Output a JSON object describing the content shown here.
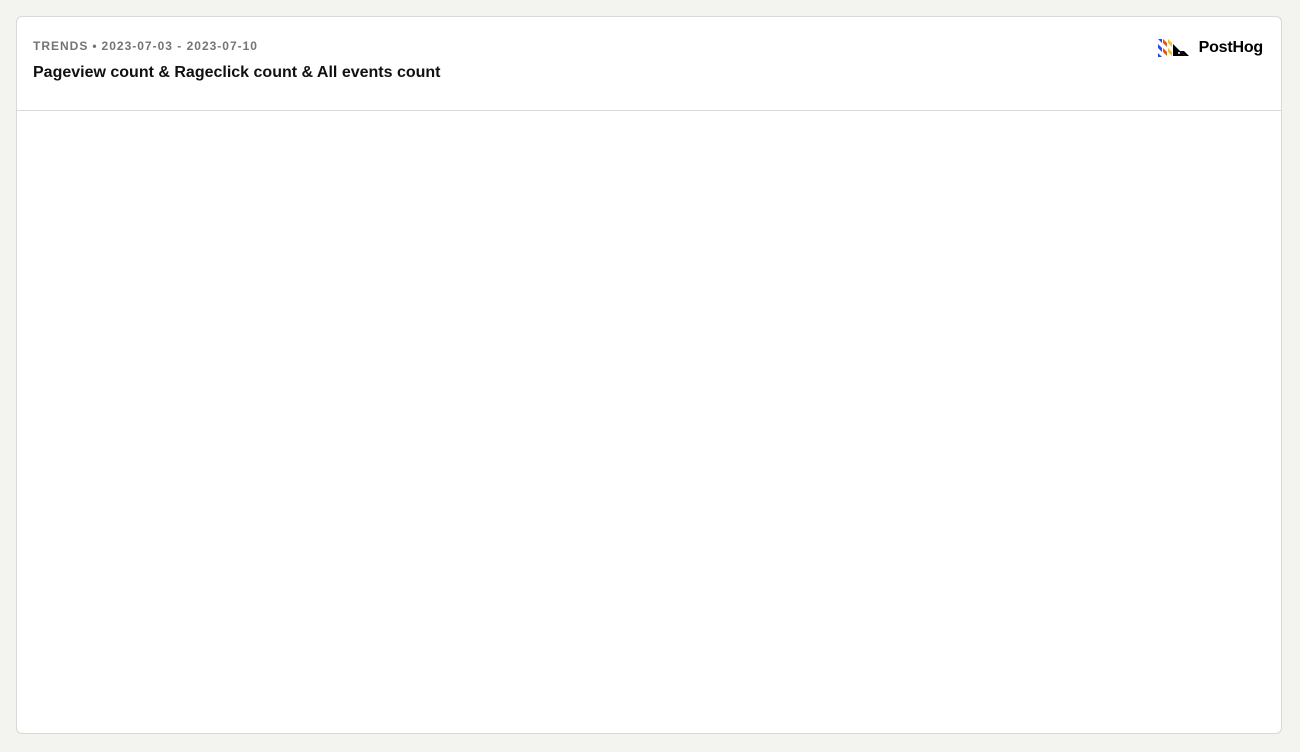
{
  "insight": {
    "type_label": "TRENDS",
    "separator": "•",
    "date_range": "2023-07-03 - 2023-07-10",
    "title": "Pageview count & Rageclick count & All events count"
  },
  "brand": {
    "name": "PostHog",
    "icon": "posthog-logo-icon",
    "colors": {
      "blue": "#1d4aff",
      "orange": "#f54e00",
      "yellow": "#f9bd2b",
      "black": "#000000"
    }
  }
}
